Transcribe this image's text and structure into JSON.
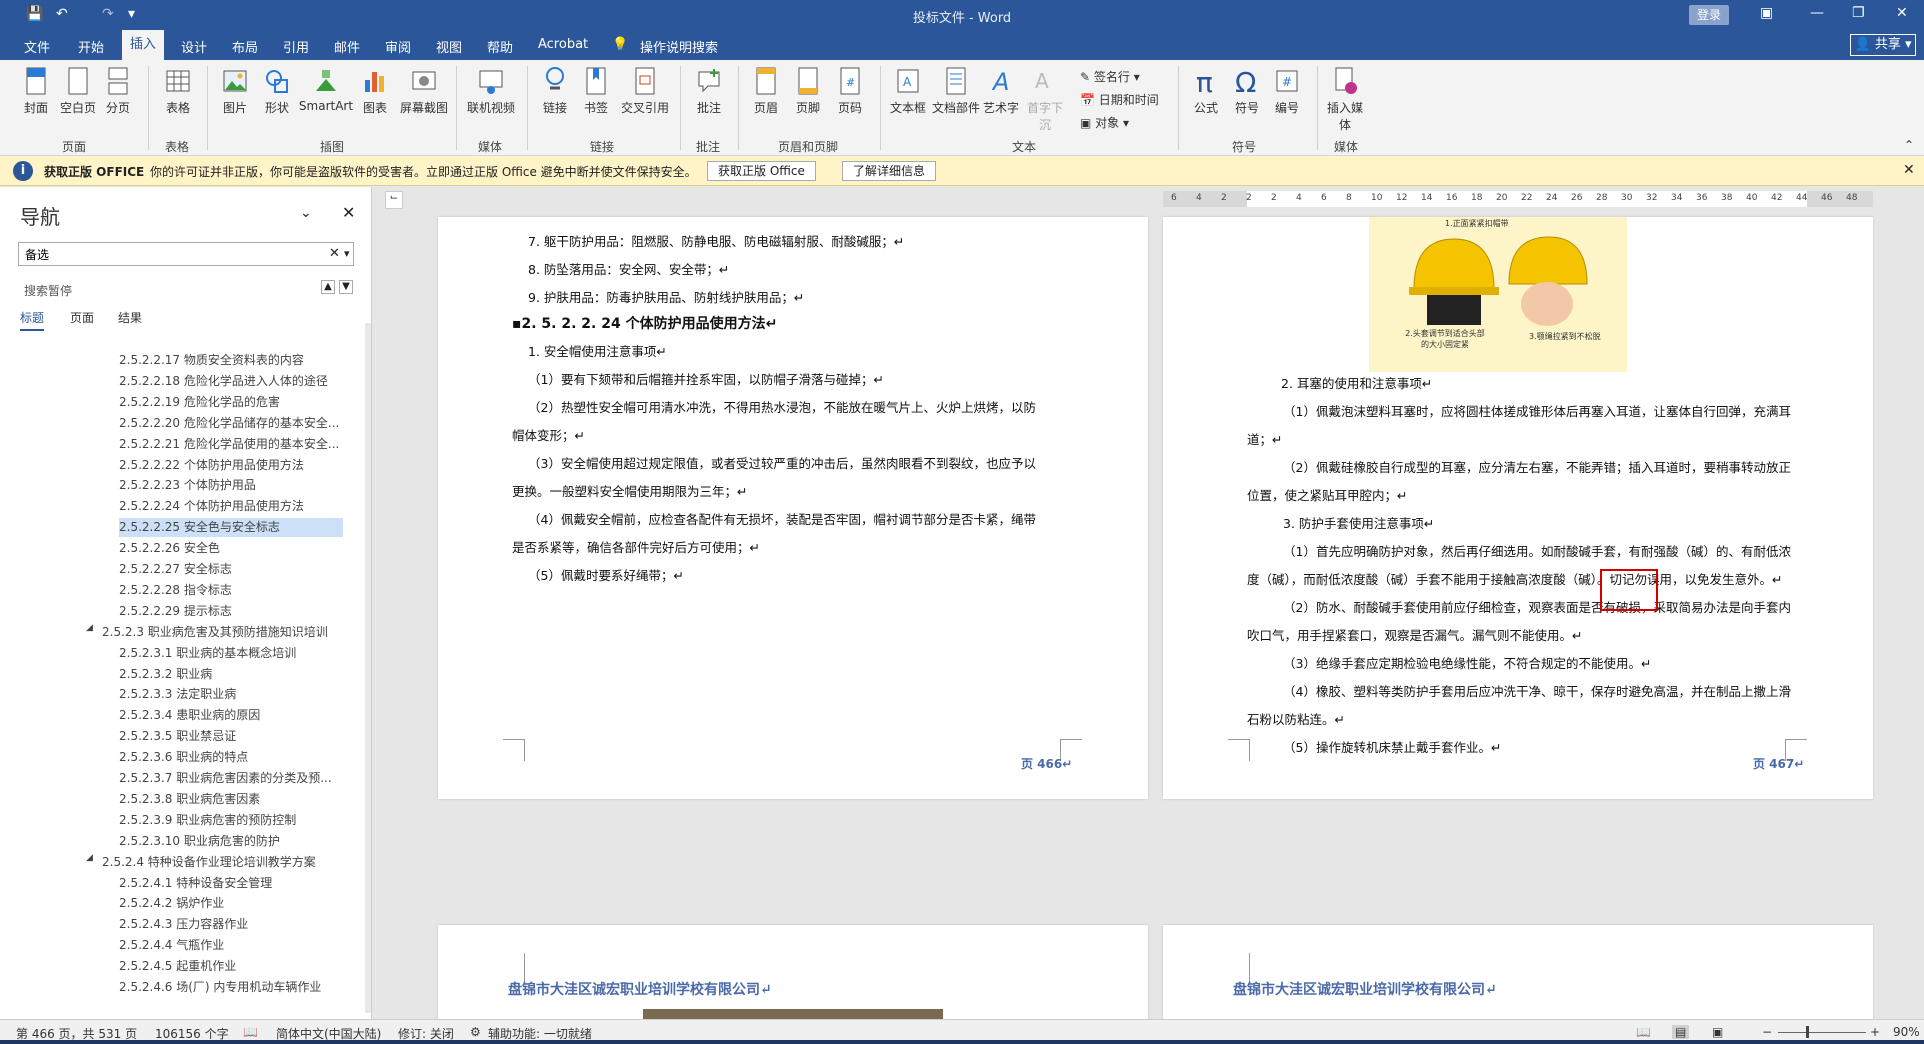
{
  "app": {
    "doc_title": "投标文件 - Word",
    "login": "登录",
    "share": "共享"
  },
  "tabs": [
    "文件",
    "开始",
    "插入",
    "设计",
    "布局",
    "引用",
    "邮件",
    "审阅",
    "视图",
    "帮助",
    "Acrobat",
    "操作说明搜索"
  ],
  "ribbon": {
    "pages": {
      "cover": "封面",
      "blank": "空白页",
      "break": "分页",
      "label": "页面"
    },
    "table": {
      "table": "表格",
      "label": "表格"
    },
    "illus": {
      "picture": "图片",
      "shape": "形状",
      "smartart": "SmartArt",
      "chart": "图表",
      "screenshot": "屏幕截图",
      "label": "插图"
    },
    "media": {
      "online_video": "联机视频",
      "label": "媒体"
    },
    "links": {
      "link": "链接",
      "bookmark": "书签",
      "xref": "交叉引用",
      "label": "链接"
    },
    "comments": {
      "comment": "批注",
      "label": "批注"
    },
    "hf": {
      "header": "页眉",
      "footer": "页脚",
      "pagenum": "页码",
      "label": "页眉和页脚"
    },
    "text": {
      "textbox": "文本框",
      "parts": "文档部件",
      "wordart": "艺术字",
      "dropcap": "首字下沉",
      "sigline": "签名行",
      "datetime": "日期和时间",
      "object": "对象",
      "label": "文本"
    },
    "symbols": {
      "equation": "公式",
      "symbol": "符号",
      "number": "编号",
      "label": "符号"
    },
    "media2": {
      "insert_media": "插入媒体",
      "label": "媒体"
    }
  },
  "banner": {
    "bold": "获取正版 OFFICE",
    "text": "你的许可证并非正版，你可能是盗版软件的受害者。立即通过正版 Office 避免中断并使文件保持安全。",
    "btn1": "获取正版 Office",
    "btn2": "了解详细信息"
  },
  "nav": {
    "title": "导航",
    "search_value": "备选",
    "pause": "搜索暂停",
    "tabs": [
      "标题",
      "页面",
      "结果"
    ],
    "items": [
      "2.5.2.2.17 物质安全资料表的内容",
      "2.5.2.2.18 危险化学品进入人体的途径",
      "2.5.2.2.19 危险化学品的危害",
      "2.5.2.2.20 危险化学品储存的基本安全...",
      "2.5.2.2.21 危险化学品使用的基本安全...",
      "2.5.2.2.22  个体防护用品使用方法",
      "2.5.2.2.23 个体防护用品",
      "2.5.2.2.24 个体防护用品使用方法",
      "2.5.2.2.25  安全色与安全标志",
      "2.5.2.2.26 安全色",
      "2.5.2.2.27 安全标志",
      "2.5.2.2.28 指令标志",
      "2.5.2.2.29 提示标志",
      "2.5.2.3 职业病危害及其预防措施知识培训",
      "2.5.2.3.1  职业病的基本概念培训",
      "2.5.2.3.2 职业病",
      "2.5.2.3.3 法定职业病",
      "2.5.2.3.4 患职业病的原因",
      "2.5.2.3.5 职业禁忌证",
      "2.5.2.3.6 职业病的特点",
      "2.5.2.3.7  职业病危害因素的分类及预...",
      "2.5.2.3.8 职业病危害因素",
      "2.5.2.3.9 职业病危害的预防控制",
      "2.5.2.3.10 职业病危害的防护",
      "2.5.2.4 特种设备作业理论培训教学方案",
      "2.5.2.4.1 特种设备安全管理",
      "2.5.2.4.2 锅炉作业",
      "2.5.2.4.3 压力容器作业",
      "2.5.2.4.4 气瓶作业",
      "2.5.2.4.5 起重机作业",
      "2.5.2.4.6 场(厂) 内专用机动车辆作业"
    ]
  },
  "page466": {
    "lines": [
      "7. 躯干防护用品：阻燃服、防静电服、防电磁辐射服、耐酸碱服；↵",
      "8. 防坠落用品：安全网、安全带；↵",
      "9. 护肤用品：防毒护肤用品、防射线护肤用品；↵",
      "▪2. 5. 2. 2. 24 个体防护用品使用方法↵",
      "1. 安全帽使用注意事项↵",
      "（1）要有下颏带和后帽箍并拴系牢固，以防帽子滑落与碰掉；↵",
      "（2）热塑性安全帽可用清水冲洗，不得用热水浸泡，不能放在暖气片上、火炉上烘烤，以防",
      "帽体变形；↵",
      "（3）安全帽使用超过规定限值，或者受过较严重的冲击后，虽然肉眼看不到裂纹，也应予以",
      "更换。一般塑料安全帽使用期限为三年；↵",
      "（4）佩戴安全帽前，应检查各配件有无损坏，装配是否牢固，帽衬调节部分是否卡紧，绳带",
      "是否系紧等，确信各部件完好后方可使用；↵",
      "（5）佩戴时要系好绳带；↵"
    ],
    "pnum": "页 466↵"
  },
  "page467": {
    "img_cap1": "1.正面紧紧扣帽带",
    "img_cap2": "2.头套调节到适合头部的大小固定紧",
    "img_cap3": "3.颚绳拉紧到不松脱",
    "lines": [
      "2. 耳塞的使用和注意事项↵",
      "（1）佩戴泡沫塑料耳塞时，应将圆柱体搓成锥形体后再塞入耳道，让塞体自行回弹，充满耳",
      "道；↵",
      "（2）佩戴硅橡胶自行成型的耳塞，应分清左右塞，不能弄错；插入耳道时，要稍事转动放正",
      "位置，使之紧贴耳甲腔内；↵",
      "3. 防护手套使用注意事项↵",
      "（1）首先应明确防护对象，然后再仔细选用。如耐酸碱手套，有耐强酸（碱）的、有耐低浓",
      "度（碱），而耐低浓度酸（碱）手套不能用于接触高浓度酸（碱）。切记勿误用，以免发生意外。↵",
      "（2）防水、耐酸碱手套使用前应仔细检查，观察表面是否有破损，采取简易办法是向手套内",
      "吹口气，用手捏紧套口，观察是否漏气。漏气则不能使用。↵",
      "（3）绝缘手套应定期检验电绝缘性能，不符合规定的不能使用。↵",
      "（4）橡胶、塑料等类防护手套用后应冲洗干净、晾干，保存时避免高温，并在制品上撒上滑",
      "石粉以防粘连。↵",
      "（5）操作旋转机床禁止戴手套作业。↵"
    ],
    "pnum": "页 467↵"
  },
  "school": "盘锦市大洼区诚宏职业培训学校有限公司↵",
  "ruler": [
    "6",
    "4",
    "2",
    "2",
    "2",
    "4",
    "6",
    "8",
    "10",
    "12",
    "14",
    "16",
    "18",
    "20",
    "22",
    "24",
    "26",
    "28",
    "30",
    "32",
    "34",
    "36",
    "38",
    "40",
    "42",
    "44",
    "46",
    "48"
  ],
  "status": {
    "page": "第 466 页，共 531 页",
    "words": "106156 个字",
    "lang": "简体中文(中国大陆)",
    "track": "修订: 关闭",
    "access": "辅助功能: 一切就绪",
    "zoom": "90%"
  },
  "colors": {
    "brand": "#2b579a",
    "highlight": "#d40000"
  }
}
